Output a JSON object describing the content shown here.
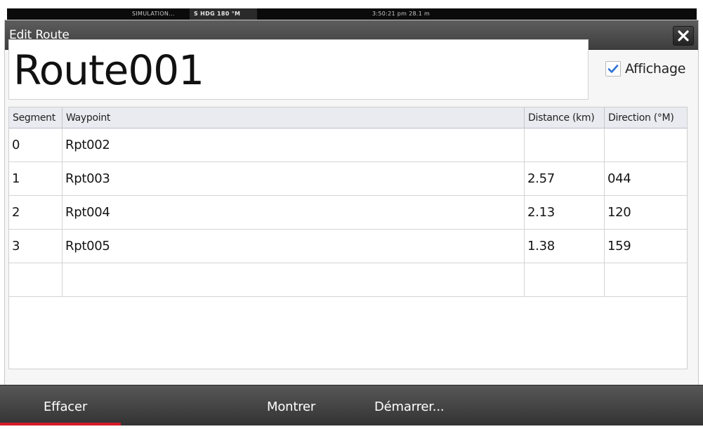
{
  "status_bar": {
    "simulation": "SIMULATION...",
    "heading": "S HDG 180 °M",
    "time_depth": "3:50:21 pm   28.1 m"
  },
  "dialog": {
    "title": "Edit Route",
    "close_icon": "close-icon"
  },
  "route": {
    "name": "Route001",
    "show_label": "Affichage",
    "show_checked": true
  },
  "table": {
    "headers": [
      "Segment",
      "Waypoint",
      "Distance (km)",
      "Direction (°M)"
    ],
    "rows": [
      {
        "segment": "0",
        "waypoint": "Rpt002",
        "distance": "",
        "direction": ""
      },
      {
        "segment": "1",
        "waypoint": "Rpt003",
        "distance": "2.57",
        "direction": "044"
      },
      {
        "segment": "2",
        "waypoint": "Rpt004",
        "distance": "2.13",
        "direction": "120"
      },
      {
        "segment": "3",
        "waypoint": "Rpt005",
        "distance": "1.38",
        "direction": "159"
      },
      {
        "segment": "",
        "waypoint": "",
        "distance": "",
        "direction": ""
      }
    ]
  },
  "toolbar": {
    "clear_label": "Effacer",
    "show_label": "Montrer",
    "start_label": "Démarrer..."
  },
  "colors": {
    "title_bar": "#4a4a4a",
    "accent_red": "#d8192b",
    "check_blue": "#2b6fd6"
  }
}
